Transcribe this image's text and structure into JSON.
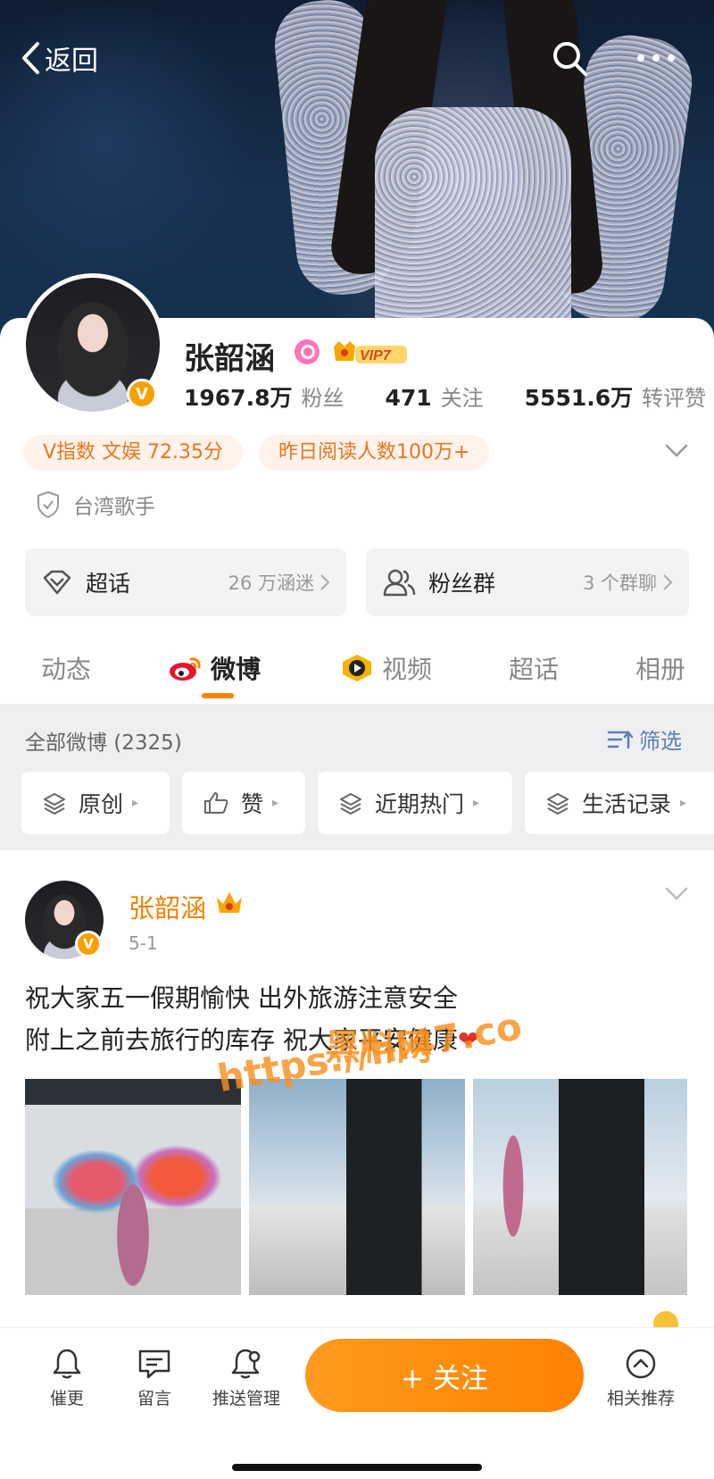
{
  "topbar": {
    "back_label": "返回"
  },
  "profile": {
    "name": "张韶涵",
    "vip_badge": "VIP7",
    "stats": [
      {
        "value": "1967.8万",
        "label": "粉丝"
      },
      {
        "value": "471",
        "label": "关注"
      },
      {
        "value": "5551.6万",
        "label": "转评赞"
      }
    ],
    "tags": [
      "V指数 文娱 72.35分",
      "昨日阅读人数100万+"
    ],
    "certification": "台湾歌手",
    "quick_links": [
      {
        "label": "超话",
        "sub": "26 万涵迷"
      },
      {
        "label": "粉丝群",
        "sub": "3 个群聊"
      }
    ]
  },
  "tabs": [
    {
      "label": "动态",
      "active": false
    },
    {
      "label": "微博",
      "active": true
    },
    {
      "label": "视频",
      "active": false
    },
    {
      "label": "超话",
      "active": false
    },
    {
      "label": "相册",
      "active": false
    }
  ],
  "filter": {
    "count_label": "全部微博 (2325)",
    "filter_label": "筛选",
    "chips": [
      "原创",
      "赞",
      "近期热门",
      "生活记录"
    ]
  },
  "post": {
    "author": "张韶涵",
    "date": "5-1",
    "text_line1": "祝大家五一假期愉快 出外旅游注意安全",
    "text_line2": "附上之前去旅行的库存 祝大家平安健康",
    "heart": "❤"
  },
  "watermark": {
    "line1": "黑料网",
    "line2": "https://hl47.co"
  },
  "bottombar": {
    "items": [
      "催更",
      "留言",
      "推送管理"
    ],
    "follow_label": "+ 关注",
    "recommend_label": "相关推荐"
  },
  "colors": {
    "accent": "#ff8200",
    "name_orange": "#f08300",
    "link_blue": "#5b7fb8",
    "tag_bg": "#fff2ea"
  }
}
